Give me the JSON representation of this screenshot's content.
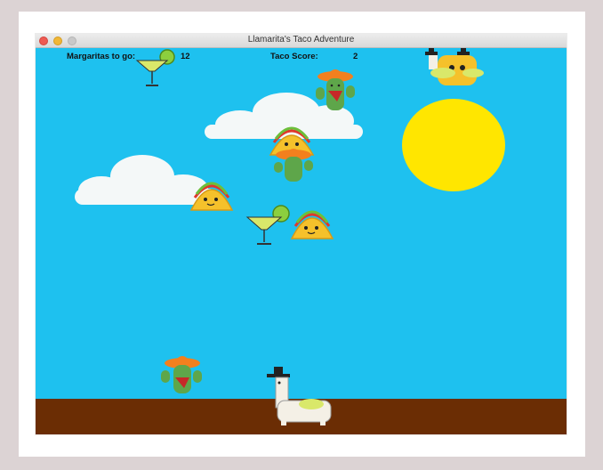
{
  "window": {
    "title": "Llamarita's Taco Adventure"
  },
  "hud": {
    "margaritas_label": "Margaritas to go:",
    "margaritas_value": "12",
    "taco_label": "Taco Score:",
    "taco_value": "2"
  },
  "colors": {
    "page_background": "#dcd3d4",
    "sky": "#1ec1ef",
    "ground": "#6b2d04",
    "sun": "#ffe600",
    "cloud": "#f4f8f8",
    "taco_shell": "#f5c12b",
    "cactus": "#5ea64a",
    "sombrero": "#f2801e",
    "margarita": "#d9e86a"
  },
  "sprites": [
    "sun",
    "cloud",
    "cloud",
    "margarita-glass",
    "margarita-glass",
    "cactus-with-sombrero",
    "cactus-with-sombrero",
    "cactus-with-sombrero",
    "taco-character",
    "taco-character",
    "taco-character",
    "taco-character",
    "llama-player-with-hat",
    "llama-with-hat"
  ]
}
